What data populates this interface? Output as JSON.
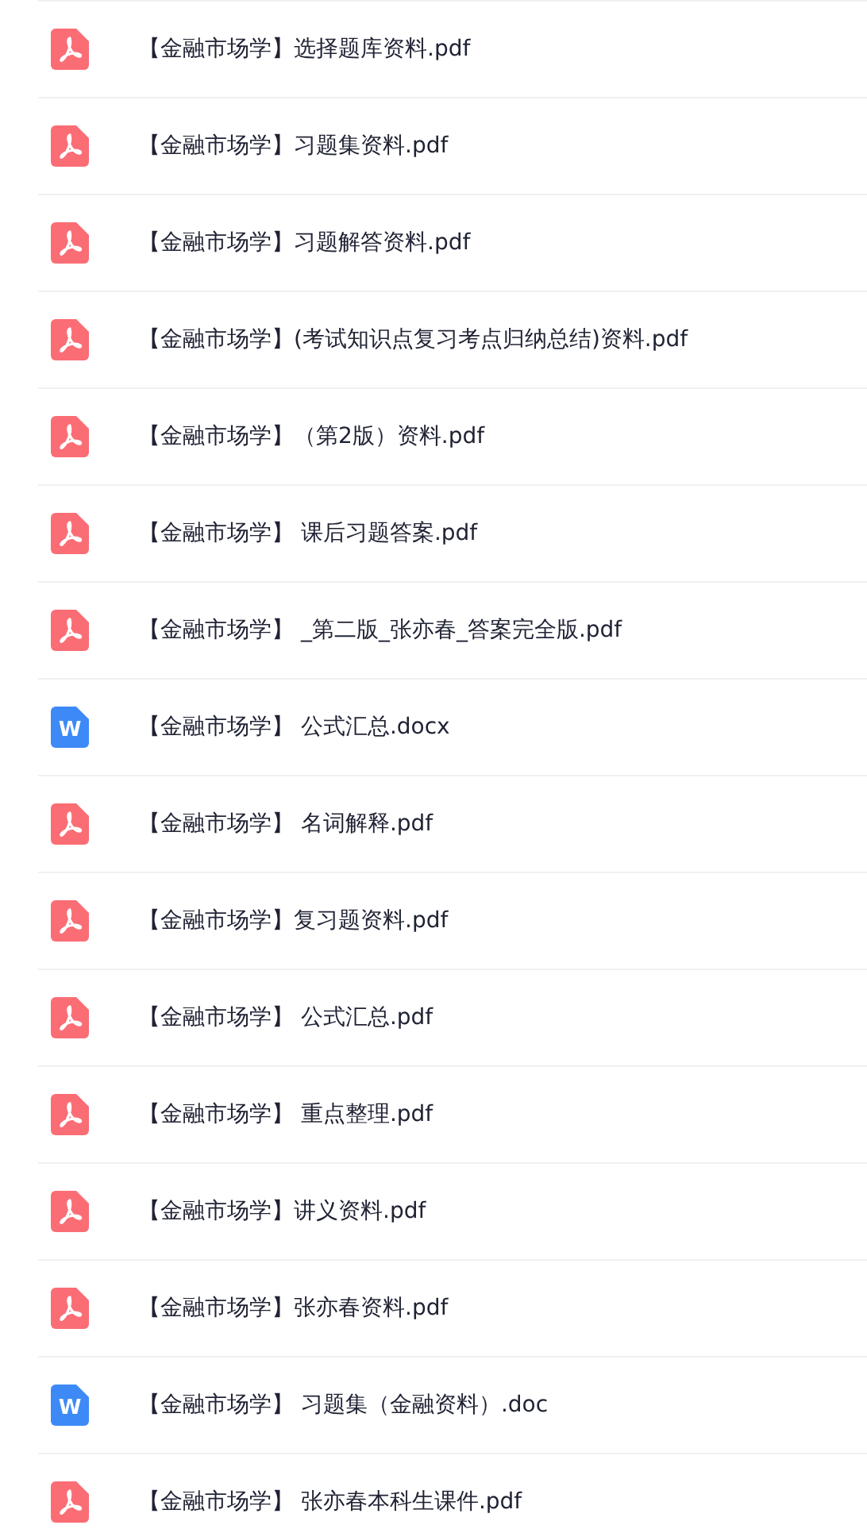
{
  "files": [
    {
      "kind": "pdf",
      "name": "【金融市场学】选择题库资料.pdf"
    },
    {
      "kind": "pdf",
      "name": "【金融市场学】习题集资料.pdf"
    },
    {
      "kind": "pdf",
      "name": "【金融市场学】习题解答资料.pdf"
    },
    {
      "kind": "pdf",
      "name": "【金融市场学】(考试知识点复习考点归纳总结)资料.pdf"
    },
    {
      "kind": "pdf",
      "name": "【金融市场学】（第2版）资料.pdf"
    },
    {
      "kind": "pdf",
      "name": "【金融市场学】 课后习题答案.pdf"
    },
    {
      "kind": "pdf",
      "name": "【金融市场学】 _第二版_张亦春_答案完全版.pdf"
    },
    {
      "kind": "word",
      "icon_letter": "W",
      "name": "【金融市场学】 公式汇总.docx"
    },
    {
      "kind": "pdf",
      "name": "【金融市场学】 名词解释.pdf"
    },
    {
      "kind": "pdf",
      "name": "【金融市场学】复习题资料.pdf"
    },
    {
      "kind": "pdf",
      "name": "【金融市场学】 公式汇总.pdf"
    },
    {
      "kind": "pdf",
      "name": "【金融市场学】 重点整理.pdf"
    },
    {
      "kind": "pdf",
      "name": "【金融市场学】讲义资料.pdf"
    },
    {
      "kind": "pdf",
      "name": "【金融市场学】张亦春资料.pdf"
    },
    {
      "kind": "word",
      "icon_letter": "W",
      "name": "【金融市场学】 习题集（金融资料）.doc"
    },
    {
      "kind": "pdf",
      "name": "【金融市场学】 张亦春本科生课件.pdf"
    }
  ]
}
